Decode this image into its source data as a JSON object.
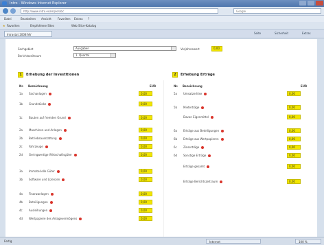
{
  "window": {
    "title": "Intro - Windows Internet Explorer"
  },
  "address": {
    "url": "http://www.intro.example/abc",
    "search_placeholder": "Google"
  },
  "menu": [
    "Datei",
    "Bearbeiten",
    "Ansicht",
    "Favoriten",
    "Extras",
    "?"
  ],
  "favorites": {
    "label": "Favoriten",
    "items": [
      "Empfohlene Sites",
      "Web Slice-Katalog"
    ]
  },
  "tab": {
    "title": "Intrastat 2008 NV"
  },
  "tools": [
    "Seite",
    "Sicherheit",
    "Extras"
  ],
  "form": {
    "meldepflichtig_label": "Sachgebiet",
    "meldepflichtig_value": "Ausgaben",
    "meldezeitraum_label": "Berichtszeitraum",
    "meldezeitraum_value": "1. Quartal",
    "vz_label": "Vorjahreswert",
    "vz_value": "0,00"
  },
  "left_section": {
    "num": "1",
    "title": "Erhebung der Investitionen",
    "col_nr": "Nr.",
    "col_desc": "Bezeichnung",
    "col_eur": "EUR",
    "rows": [
      {
        "n": "1a",
        "d": "Sachanlagen",
        "v": "0,00"
      },
      {
        "n": "1b",
        "d": "Grundstücke",
        "v": "0,00"
      },
      {
        "n": "1c",
        "d": "Bauten auf fremden Grund",
        "v": "0,00"
      },
      {
        "n": "2a",
        "d": "Maschinen und Anlagen",
        "v": "0,00"
      },
      {
        "n": "2b",
        "d": "Betriebsausstattung",
        "v": "0,00"
      },
      {
        "n": "2c",
        "d": "Fahrzeuge",
        "v": "0,00"
      },
      {
        "n": "2d",
        "d": "Geringwertige Wirtschaftsgüter",
        "v": "0,00"
      },
      {
        "n": "3a",
        "d": "Immaterielle Güter",
        "v": "0,00"
      },
      {
        "n": "3b",
        "d": "Software und Lizenzen",
        "v": "0,00"
      },
      {
        "n": "4a",
        "d": "Finanzanlagen",
        "v": "0,00"
      },
      {
        "n": "4b",
        "d": "Beteiligungen",
        "v": "0,00"
      },
      {
        "n": "4c",
        "d": "Ausleihungen",
        "v": "0,00"
      },
      {
        "n": "4d",
        "d": "Wertpapiere des Anlagevermögens",
        "v": "0,00"
      }
    ]
  },
  "right_section": {
    "num": "2",
    "title": "Erhebung Erträge",
    "col_nr": "Nr.",
    "col_desc": "Bezeichnung",
    "col_eur": "EUR",
    "rows": [
      {
        "n": "5a",
        "d": "Umsatzerlöse",
        "v": "0,00"
      },
      {
        "n": "5b",
        "d": "Mieterträge",
        "v": "0,00"
      },
      {
        "n": "",
        "d": "Davon Eigenmittel",
        "v": "0,00"
      },
      {
        "n": "6a",
        "d": "Erträge aus Beteiligungen",
        "v": "0,00"
      },
      {
        "n": "6b",
        "d": "Erträge aus Wertpapieren",
        "v": "0,00"
      },
      {
        "n": "6c",
        "d": "Zinserträge",
        "v": "0,00"
      },
      {
        "n": "6d",
        "d": "Sonstige Erträge",
        "v": "0,00"
      },
      {
        "n": "",
        "d": "Erträge gesamt",
        "v": "0,00"
      },
      {
        "n": "",
        "d": "Erträge Berichtszeitraum",
        "v": "0,00"
      }
    ]
  },
  "status": {
    "text": "Fertig",
    "zone": "Internet",
    "zoom": "100 %"
  }
}
